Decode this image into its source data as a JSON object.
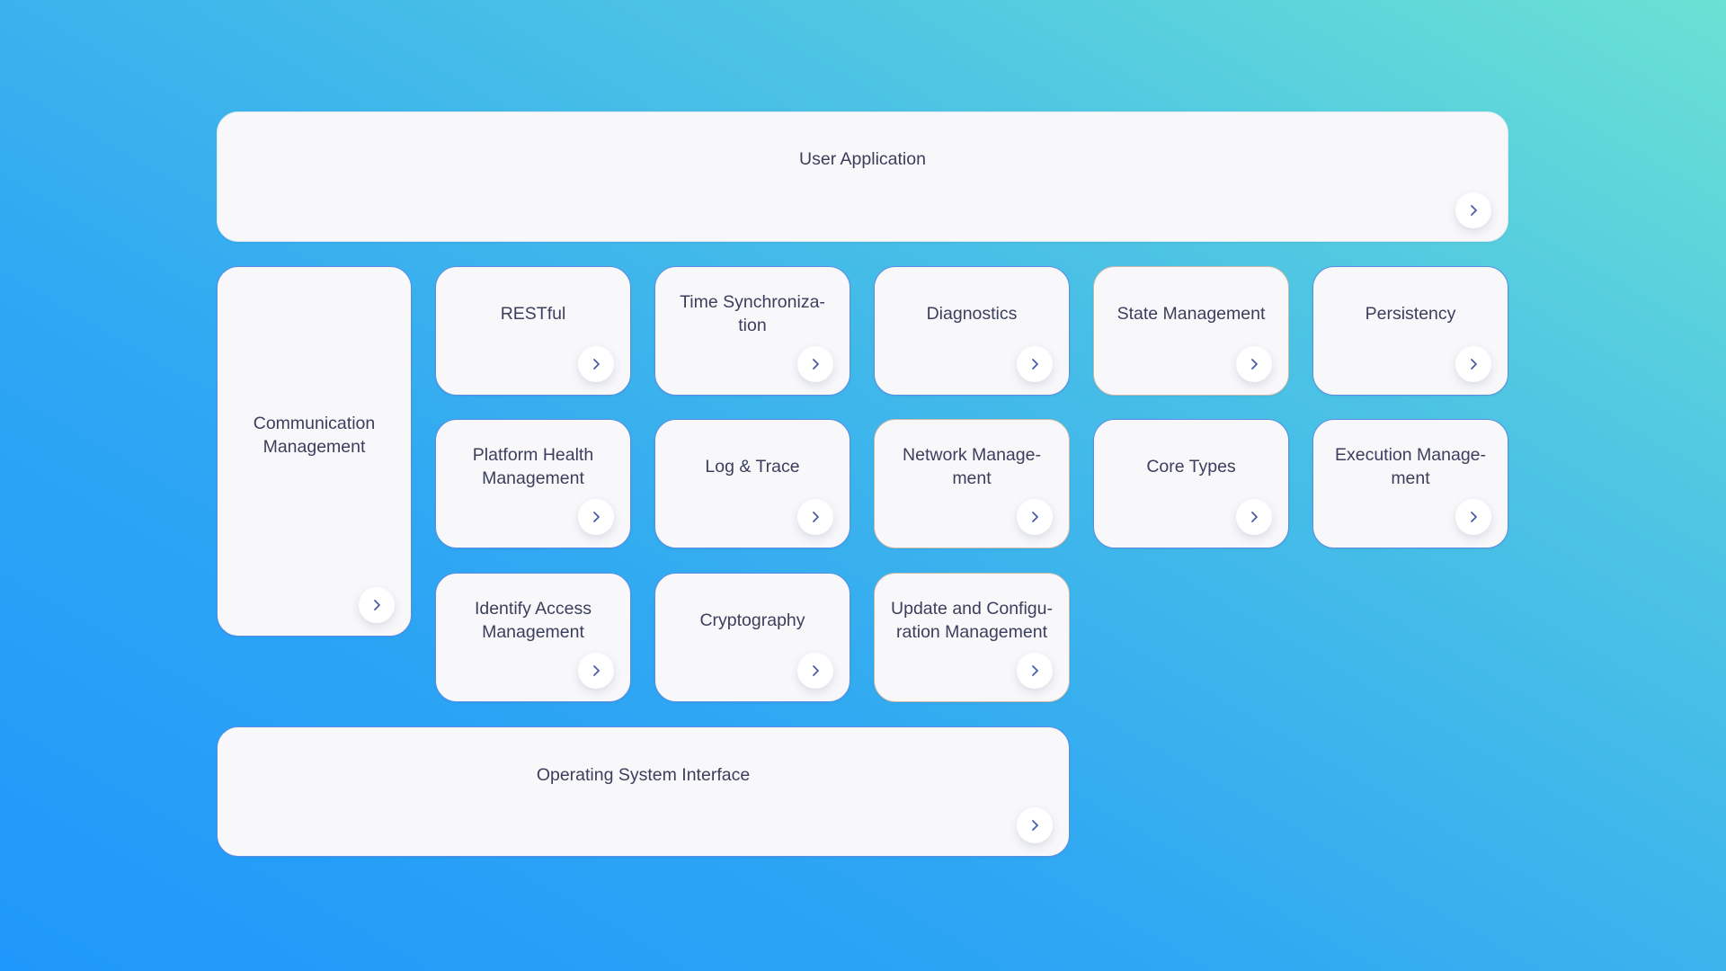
{
  "colors": {
    "background_start": "#1f98fb",
    "background_end": "#6ae1d3",
    "card_fill": "#f8f8fb",
    "card_border": "#5c8fe3",
    "card_border_muted": "#c9b9ad",
    "text": "#3b3e5c",
    "chevron": "#4a5ba8"
  },
  "layers": {
    "user_application": {
      "label": "User Application",
      "icon": "chevron-right-icon"
    },
    "communication_management": {
      "label": "Communication Management",
      "icon": "chevron-right-icon"
    },
    "operating_system_interface": {
      "label": "Operating System Interface",
      "icon": "chevron-right-icon"
    }
  },
  "modules": [
    {
      "label": "RESTful",
      "icon": "chevron-right-icon"
    },
    {
      "label": "Time Synchroniza-\ntion",
      "icon": "chevron-right-icon"
    },
    {
      "label": "Diagnostics",
      "icon": "chevron-right-icon"
    },
    {
      "label": "State Management",
      "icon": "chevron-right-icon"
    },
    {
      "label": "Persistency",
      "icon": "chevron-right-icon"
    },
    {
      "label": "Platform Health Management",
      "icon": "chevron-right-icon"
    },
    {
      "label": "Log & Trace",
      "icon": "chevron-right-icon"
    },
    {
      "label": "Network Manage-\nment",
      "icon": "chevron-right-icon"
    },
    {
      "label": "Core Types",
      "icon": "chevron-right-icon"
    },
    {
      "label": "Execution Manage-\nment",
      "icon": "chevron-right-icon"
    },
    {
      "label": "Identify Access Management",
      "icon": "chevron-right-icon"
    },
    {
      "label": "Cryptography",
      "icon": "chevron-right-icon"
    },
    {
      "label": "Update and Configu-\nration Management",
      "icon": "chevron-right-icon"
    }
  ]
}
